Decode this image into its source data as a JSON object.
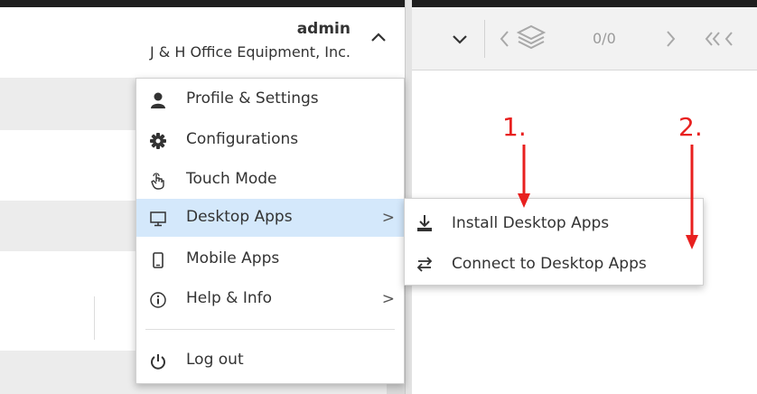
{
  "header": {
    "username": "admin",
    "company": "J & H Office Equipment, Inc."
  },
  "toolbar": {
    "page_count": "0/0"
  },
  "user_menu": {
    "items": [
      {
        "label": "Profile & Settings",
        "icon": "user-icon"
      },
      {
        "label": "Configurations",
        "icon": "gear-icon"
      },
      {
        "label": "Touch Mode",
        "icon": "touch-hand-icon"
      },
      {
        "label": "Desktop Apps",
        "icon": "monitor-icon",
        "submenu_arrow": ">",
        "highlighted": true
      },
      {
        "label": "Mobile Apps",
        "icon": "mobile-icon"
      },
      {
        "label": "Help & Info",
        "icon": "info-icon",
        "submenu_arrow": ">"
      },
      {
        "label": "Log out",
        "icon": "power-icon"
      }
    ]
  },
  "desktop_apps_submenu": {
    "items": [
      {
        "label": "Install Desktop Apps",
        "icon": "download-icon"
      },
      {
        "label": "Connect to Desktop Apps",
        "icon": "swap-arrows-icon"
      }
    ]
  },
  "annotations": {
    "step1": "1.",
    "step2": "2.",
    "color": "#e8201f"
  },
  "colors": {
    "highlight": "#d4e8fb",
    "toolbar_bg": "#f2f2f2",
    "band_bg": "#ececec"
  }
}
